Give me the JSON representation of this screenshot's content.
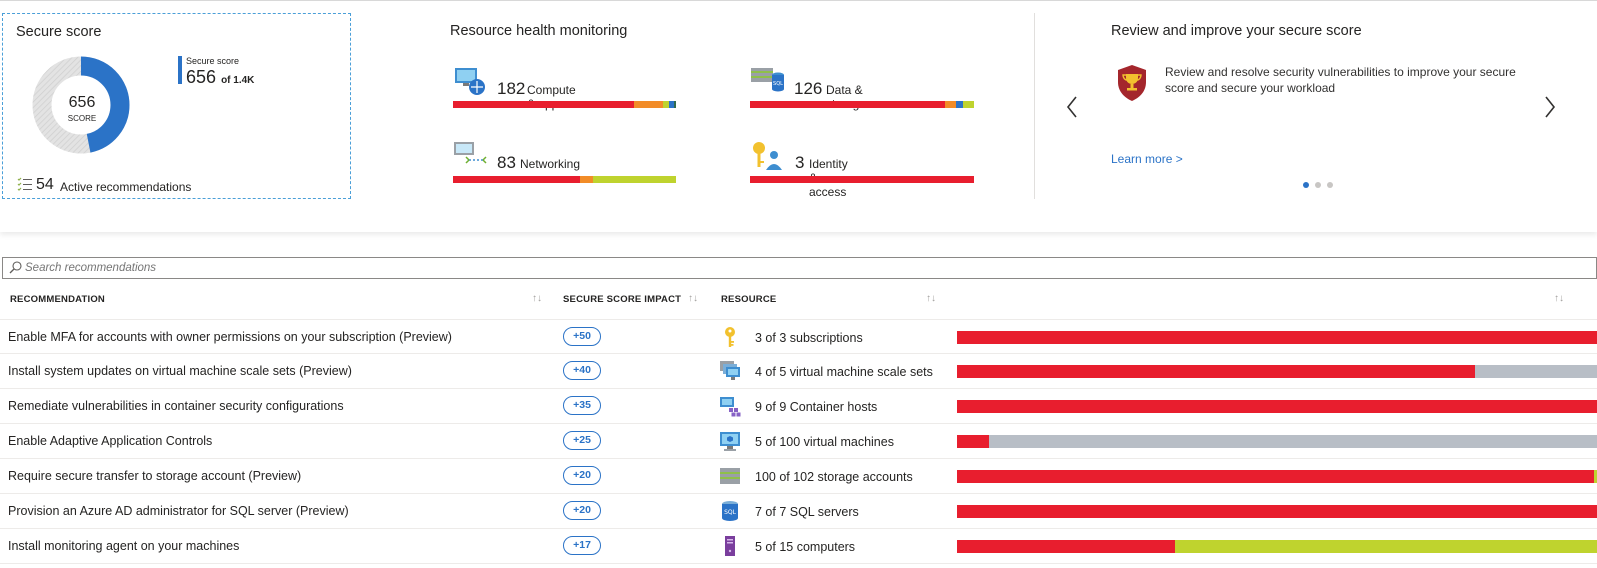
{
  "secure_score_card": {
    "title": "Secure score",
    "score": "656",
    "score_label": "SCORE",
    "legend_label": "Secure score",
    "legend_value": "656",
    "legend_of": "of 1.4K",
    "score_fraction": 0.468,
    "active_count": "54",
    "active_label": "Active recommendations"
  },
  "resource_health": {
    "title": "Resource health monitoring",
    "items": [
      {
        "count": "182",
        "label": "Compute & apps",
        "icon": "compute-icon",
        "segments": [
          {
            "color": "#e81e2e",
            "fraction": 0.81
          },
          {
            "color": "#f28c28",
            "fraction": 0.13
          },
          {
            "color": "#bfd32e",
            "fraction": 0.03
          },
          {
            "color": "#2b73c7",
            "fraction": 0.02
          },
          {
            "color": "#2f6b4f",
            "fraction": 0.01
          }
        ]
      },
      {
        "count": "126",
        "label": "Data & storage",
        "icon": "sql-storage-icon",
        "segments": [
          {
            "color": "#e81e2e",
            "fraction": 0.87
          },
          {
            "color": "#f28c28",
            "fraction": 0.05
          },
          {
            "color": "#2b73c7",
            "fraction": 0.03
          },
          {
            "color": "#bfd32e",
            "fraction": 0.05
          }
        ]
      },
      {
        "count": "83",
        "label": "Networking",
        "icon": "networking-icon",
        "segments": [
          {
            "color": "#e81e2e",
            "fraction": 0.57
          },
          {
            "color": "#f28c28",
            "fraction": 0.06
          },
          {
            "color": "#bfd32e",
            "fraction": 0.37
          }
        ]
      },
      {
        "count": "3",
        "label": "Identity & access",
        "icon": "identity-icon",
        "segments": [
          {
            "color": "#e81e2e",
            "fraction": 1.0
          }
        ]
      }
    ]
  },
  "promo": {
    "title": "Review and improve your secure score",
    "text": "Review and resolve security vulnerabilities to improve your secure score and secure your workload",
    "link": "Learn more >",
    "icon": "trophy-shield-icon",
    "active_page": 1,
    "page_count": 3
  },
  "search": {
    "placeholder": "Search recommendations"
  },
  "table": {
    "headers": {
      "recommendation": "RECOMMENDATION",
      "impact": "SECURE SCORE IMPACT",
      "resource": "RESOURCE",
      "sort_glyph": "↑↓"
    },
    "rows": [
      {
        "recommendation": "Enable MFA for accounts with owner permissions on your subscription (Preview)",
        "impact": "+50",
        "resource": "3 of 3 subscriptions",
        "icon": "key-icon",
        "segments": [
          {
            "color": "#e81e2e",
            "fraction": 1.0
          }
        ]
      },
      {
        "recommendation": "Install system updates on virtual machine scale sets (Preview)",
        "impact": "+40",
        "resource": "4 of 5 virtual machine scale sets",
        "icon": "vm-scale-set-icon",
        "segments": [
          {
            "color": "#e81e2e",
            "fraction": 0.81
          },
          {
            "color": "#b8bec6",
            "fraction": 0.19
          }
        ]
      },
      {
        "recommendation": "Remediate vulnerabilities in container security configurations",
        "impact": "+35",
        "resource": "9 of 9 Container hosts",
        "icon": "container-host-icon",
        "segments": [
          {
            "color": "#e81e2e",
            "fraction": 1.0
          }
        ]
      },
      {
        "recommendation": "Enable Adaptive Application Controls",
        "impact": "+25",
        "resource": "5 of 100 virtual machines",
        "icon": "virtual-machine-icon",
        "segments": [
          {
            "color": "#e81e2e",
            "fraction": 0.05
          },
          {
            "color": "#b8bec6",
            "fraction": 0.95
          }
        ]
      },
      {
        "recommendation": "Require secure transfer to storage account (Preview)",
        "impact": "+20",
        "resource": "100 of 102 storage accounts",
        "icon": "storage-account-icon",
        "segments": [
          {
            "color": "#e81e2e",
            "fraction": 0.995
          },
          {
            "color": "#bfd32e",
            "fraction": 0.005
          }
        ]
      },
      {
        "recommendation": "Provision an Azure AD administrator for SQL server (Preview)",
        "impact": "+20",
        "resource": "7 of 7 SQL servers",
        "icon": "sql-server-icon",
        "segments": [
          {
            "color": "#e81e2e",
            "fraction": 1.0
          }
        ]
      },
      {
        "recommendation": "Install monitoring agent on your machines",
        "impact": "+17",
        "resource": "5 of 15 computers",
        "icon": "computer-icon",
        "segments": [
          {
            "color": "#e81e2e",
            "fraction": 0.34
          },
          {
            "color": "#bfd32e",
            "fraction": 0.66
          }
        ]
      }
    ]
  }
}
